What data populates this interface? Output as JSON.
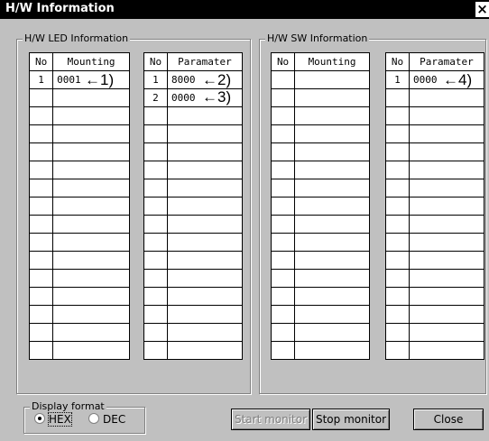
{
  "window": {
    "title": "H/W Information",
    "close_glyph": "×"
  },
  "led_group": {
    "label": "H/W LED Information",
    "mounting_table": {
      "headers": [
        "No",
        "Mounting"
      ],
      "rows": [
        [
          "1",
          "0001"
        ]
      ]
    },
    "param_table": {
      "headers": [
        "No",
        "Paramater"
      ],
      "rows": [
        [
          "1",
          "8000"
        ],
        [
          "2",
          "0000"
        ]
      ]
    }
  },
  "sw_group": {
    "label": "H/W SW Information",
    "mounting_table": {
      "headers": [
        "No",
        "Mounting"
      ],
      "rows": []
    },
    "param_table": {
      "headers": [
        "No",
        "Paramater"
      ],
      "rows": [
        [
          "1",
          "0000"
        ]
      ]
    }
  },
  "annotations": [
    "←1)",
    "←2)",
    "←3)",
    "←4)"
  ],
  "display_format": {
    "label": "Display format",
    "options": [
      "HEX",
      "DEC"
    ],
    "selected": "HEX"
  },
  "buttons": {
    "start_monitor": "Start monitor",
    "stop_monitor": "Stop monitor",
    "close": "Close"
  },
  "colors": {
    "title_bg": "#000000",
    "face": "#c0c0c0",
    "grid_bg": "#ffffff",
    "disabled_text": "#808080"
  }
}
